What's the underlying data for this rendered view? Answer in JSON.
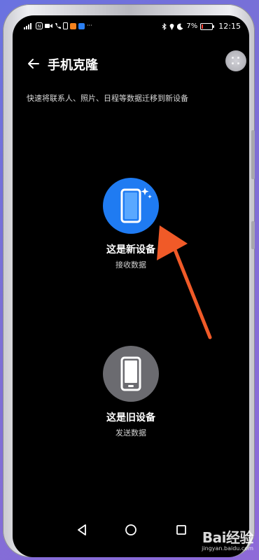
{
  "status_bar": {
    "left_icons": [
      "signal-icon",
      "nfc-icon",
      "video-call-icon",
      "phone-icon",
      "sim-icon",
      "app-orange-icon",
      "app-blue-icon"
    ],
    "more": "···",
    "battery_percent": "7%",
    "time": "12:15"
  },
  "header": {
    "title": "手机克隆"
  },
  "subtitle": "快速将联系人、照片、日程等数据迁移到新设备",
  "options": {
    "new_device": {
      "label": "这是新设备",
      "sub": "接收数据",
      "color": "#1f7bf2"
    },
    "old_device": {
      "label": "这是旧设备",
      "sub": "发送数据",
      "color": "#6b6b70"
    }
  },
  "annotation_color": "#f05a28",
  "watermark": {
    "logo": "Bai经验",
    "url": "jingyan.baidu.com"
  }
}
